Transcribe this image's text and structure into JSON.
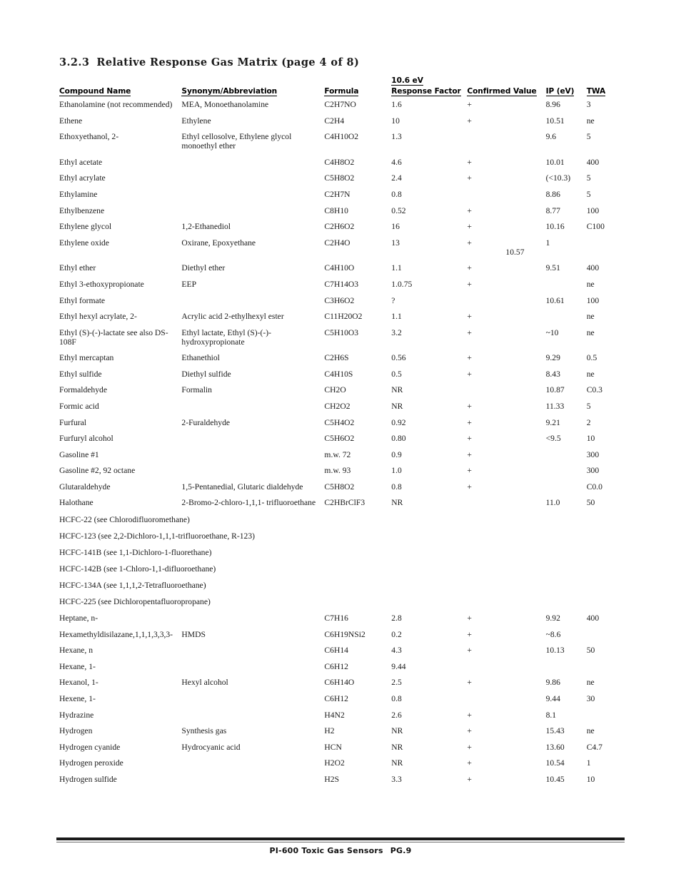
{
  "heading": {
    "number": "3.2.3",
    "title": "Relative Response Gas Matrix (page 4 of 8)"
  },
  "table": {
    "ev_label": "10.6 eV",
    "headers": {
      "compound_name": "Compound Name",
      "synonym": "Synonym/Abbreviation",
      "formula": "Formula",
      "response_factor": "Response Factor",
      "confirmed_value": "Confirmed Value",
      "ip": "IP (eV)",
      "twa": "TWA"
    },
    "rows": [
      {
        "name": "Ethanolamine (not recommended)",
        "synonym": "MEA, Monoethanolamine",
        "formula": "C2H7NO",
        "rf": "1.6",
        "cv": "+",
        "ip": "8.96",
        "twa": "3"
      },
      {
        "name": "Ethene",
        "synonym": "Ethylene",
        "formula": "C2H4",
        "rf": "10",
        "cv": "+",
        "ip": "10.51",
        "twa": "ne"
      },
      {
        "name": "Ethoxyethanol, 2-",
        "synonym": "Ethyl cellosolve, Ethylene glycol monoethyl ether",
        "formula": "C4H10O2",
        "rf": "1.3",
        "cv": "",
        "ip": "9.6",
        "twa": "5"
      },
      {
        "name": "Ethyl acetate",
        "synonym": "",
        "formula": "C4H8O2",
        "rf": "4.6",
        "cv": "+",
        "ip": "10.01",
        "twa": "400"
      },
      {
        "name": "Ethyl acrylate",
        "synonym": "",
        "formula": "C5H8O2",
        "rf": "2.4",
        "cv": "+",
        "ip": "(<10.3)",
        "twa": "5"
      },
      {
        "name": "Ethylamine",
        "synonym": "",
        "formula": "C2H7N",
        "rf": "0.8",
        "cv": "",
        "ip": "8.86",
        "twa": "5"
      },
      {
        "name": "Ethylbenzene",
        "synonym": "",
        "formula": "C8H10",
        "rf": "0.52",
        "cv": "+",
        "ip": "8.77",
        "twa": "100"
      },
      {
        "name": "Ethylene glycol",
        "synonym": "1,2-Ethanediol",
        "formula": "C2H6O2",
        "rf": "16",
        "cv": "+",
        "ip": "10.16",
        "twa": "C100"
      },
      {
        "name": "Ethylene oxide",
        "synonym": "Oxirane, Epoxyethane",
        "formula": "C2H4O",
        "rf": "13",
        "cv": "+",
        "cv_extra": "10.57",
        "ip": "1",
        "twa": ""
      },
      {
        "name": "Ethyl ether",
        "synonym": "Diethyl ether",
        "formula": "C4H10O",
        "rf": "1.1",
        "cv": "+",
        "ip": "9.51",
        "twa": "400"
      },
      {
        "name": "Ethyl 3-ethoxypropionate",
        "synonym": "EEP",
        "formula": "C7H14O3",
        "rf": "1.0.75",
        "cv": "+",
        "ip": "",
        "twa": "ne"
      },
      {
        "name": "Ethyl formate",
        "synonym": "",
        "formula": "C3H6O2",
        "rf": "?",
        "cv": "",
        "ip": "10.61",
        "twa": "100"
      },
      {
        "name": "Ethyl hexyl acrylate, 2-",
        "synonym": "Acrylic acid 2-ethylhexyl ester",
        "formula": "C11H20O2",
        "rf": "1.1",
        "cv": "+",
        "ip": "",
        "twa": "ne"
      },
      {
        "name": "Ethyl (S)-(-)-lactate see also DS-108F",
        "synonym": "Ethyl lactate, Ethyl (S)-(-)-hydroxypropionate",
        "formula": "C5H10O3",
        "rf": "3.2",
        "cv": "+",
        "ip": "~10",
        "twa": "ne"
      },
      {
        "name": "Ethyl mercaptan",
        "synonym": "Ethanethiol",
        "formula": "C2H6S",
        "rf": "0.56",
        "cv": "+",
        "ip": "9.29",
        "twa": "0.5"
      },
      {
        "name": "Ethyl sulfide",
        "synonym": "Diethyl sulfide",
        "formula": "C4H10S",
        "rf": "0.5",
        "cv": "+",
        "ip": "8.43",
        "twa": "ne"
      },
      {
        "name": "Formaldehyde",
        "synonym": "Formalin",
        "formula": "CH2O",
        "rf": "NR",
        "cv": "",
        "ip": "10.87",
        "twa": "C0.3"
      },
      {
        "name": "Formic acid",
        "synonym": "",
        "formula": "CH2O2",
        "rf": "NR",
        "cv": "+",
        "ip": "11.33",
        "twa": "5"
      },
      {
        "name": "Furfural",
        "synonym": "2-Furaldehyde",
        "formula": "C5H4O2",
        "rf": "0.92",
        "cv": "+",
        "ip": "9.21",
        "twa": "2"
      },
      {
        "name": "Furfuryl alcohol",
        "synonym": "",
        "formula": "C5H6O2",
        "rf": "0.80",
        "cv": "+",
        "ip": "<9.5",
        "twa": "10"
      },
      {
        "name": "Gasoline #1",
        "synonym": "",
        "formula": "m.w. 72",
        "rf": "0.9",
        "cv": "+",
        "ip": "",
        "twa": "300"
      },
      {
        "name": "Gasoline #2, 92 octane",
        "synonym": "",
        "formula": "m.w. 93",
        "rf": "1.0",
        "cv": "+",
        "ip": "",
        "twa": "300"
      },
      {
        "name": "Glutaraldehyde",
        "synonym": "1,5-Pentanedial, Glutaric dialdehyde",
        "formula": "C5H8O2",
        "rf": "0.8",
        "cv": "+",
        "ip": "",
        "twa": "C0.0"
      },
      {
        "name": "Halothane",
        "synonym": "2-Bromo-2-chloro-1,1,1- trifluoroethane",
        "formula": "C2HBrClF3",
        "rf": "NR",
        "cv": "",
        "ip": "11.0",
        "twa": "50"
      },
      {
        "name": "HCFC-22 (see Chlorodifluoromethane)",
        "note": true
      },
      {
        "name": "HCFC-123 (see 2,2-Dichloro-1,1,1-trifluoroethane, R-123)",
        "note": true
      },
      {
        "name": "HCFC-141B (see 1,1-Dichloro-1-fluorethane)",
        "note": true
      },
      {
        "name": "HCFC-142B (see 1-Chloro-1,1-difluoroethane)",
        "note": true
      },
      {
        "name": "HCFC-134A (see 1,1,1,2-Tetrafluoroethane)",
        "note": true
      },
      {
        "name": "HCFC-225 (see Dichloropentafluoropropane)",
        "note": true
      },
      {
        "name": "Heptane, n-",
        "synonym": "",
        "formula": "C7H16",
        "rf": "2.8",
        "cv": "+",
        "ip": "9.92",
        "twa": "400"
      },
      {
        "name": "Hexamethyldisilazane,1,1,1,3,3,3-",
        "synonym": "HMDS",
        "formula": "C6H19NSi2",
        "rf": "0.2",
        "cv": "+",
        "ip": "~8.6",
        "twa": ""
      },
      {
        "name": "Hexane, n",
        "synonym": "",
        "formula": "C6H14",
        "rf": "4.3",
        "cv": "+",
        "ip": "10.13",
        "twa": "50"
      },
      {
        "name": "Hexane, 1-",
        "synonym": "",
        "formula": "C6H12",
        "rf": "9.44",
        "cv": "",
        "ip": "",
        "twa": ""
      },
      {
        "name": "Hexanol, 1-",
        "synonym": "Hexyl alcohol",
        "formula": "C6H14O",
        "rf": "2.5",
        "cv": "+",
        "ip": "9.86",
        "twa": "ne"
      },
      {
        "name": "Hexene, 1-",
        "synonym": "",
        "formula": "C6H12",
        "rf": "0.8",
        "cv": "",
        "ip": "9.44",
        "twa": "30"
      },
      {
        "name": "Hydrazine",
        "synonym": "",
        "formula": "H4N2",
        "rf": "2.6",
        "cv": "+",
        "ip": "8.1",
        "twa": ""
      },
      {
        "name": "Hydrogen",
        "synonym": "Synthesis gas",
        "formula": "H2",
        "rf": "NR",
        "cv": "+",
        "ip": "15.43",
        "twa": "ne"
      },
      {
        "name": "Hydrogen cyanide",
        "synonym": "Hydrocyanic acid",
        "formula": "HCN",
        "rf": "NR",
        "cv": "+",
        "ip": "13.60",
        "twa": "C4.7"
      },
      {
        "name": "Hydrogen peroxide",
        "synonym": "",
        "formula": "H2O2",
        "rf": "NR",
        "cv": "+",
        "ip": "10.54",
        "twa": "1"
      },
      {
        "name": "Hydrogen sulfide",
        "synonym": "",
        "formula": "H2S",
        "rf": "3.3",
        "cv": "+",
        "ip": "10.45",
        "twa": "10"
      }
    ]
  },
  "footer": {
    "document": "PI-600 Toxic Gas Sensors",
    "page": "PG.9"
  }
}
